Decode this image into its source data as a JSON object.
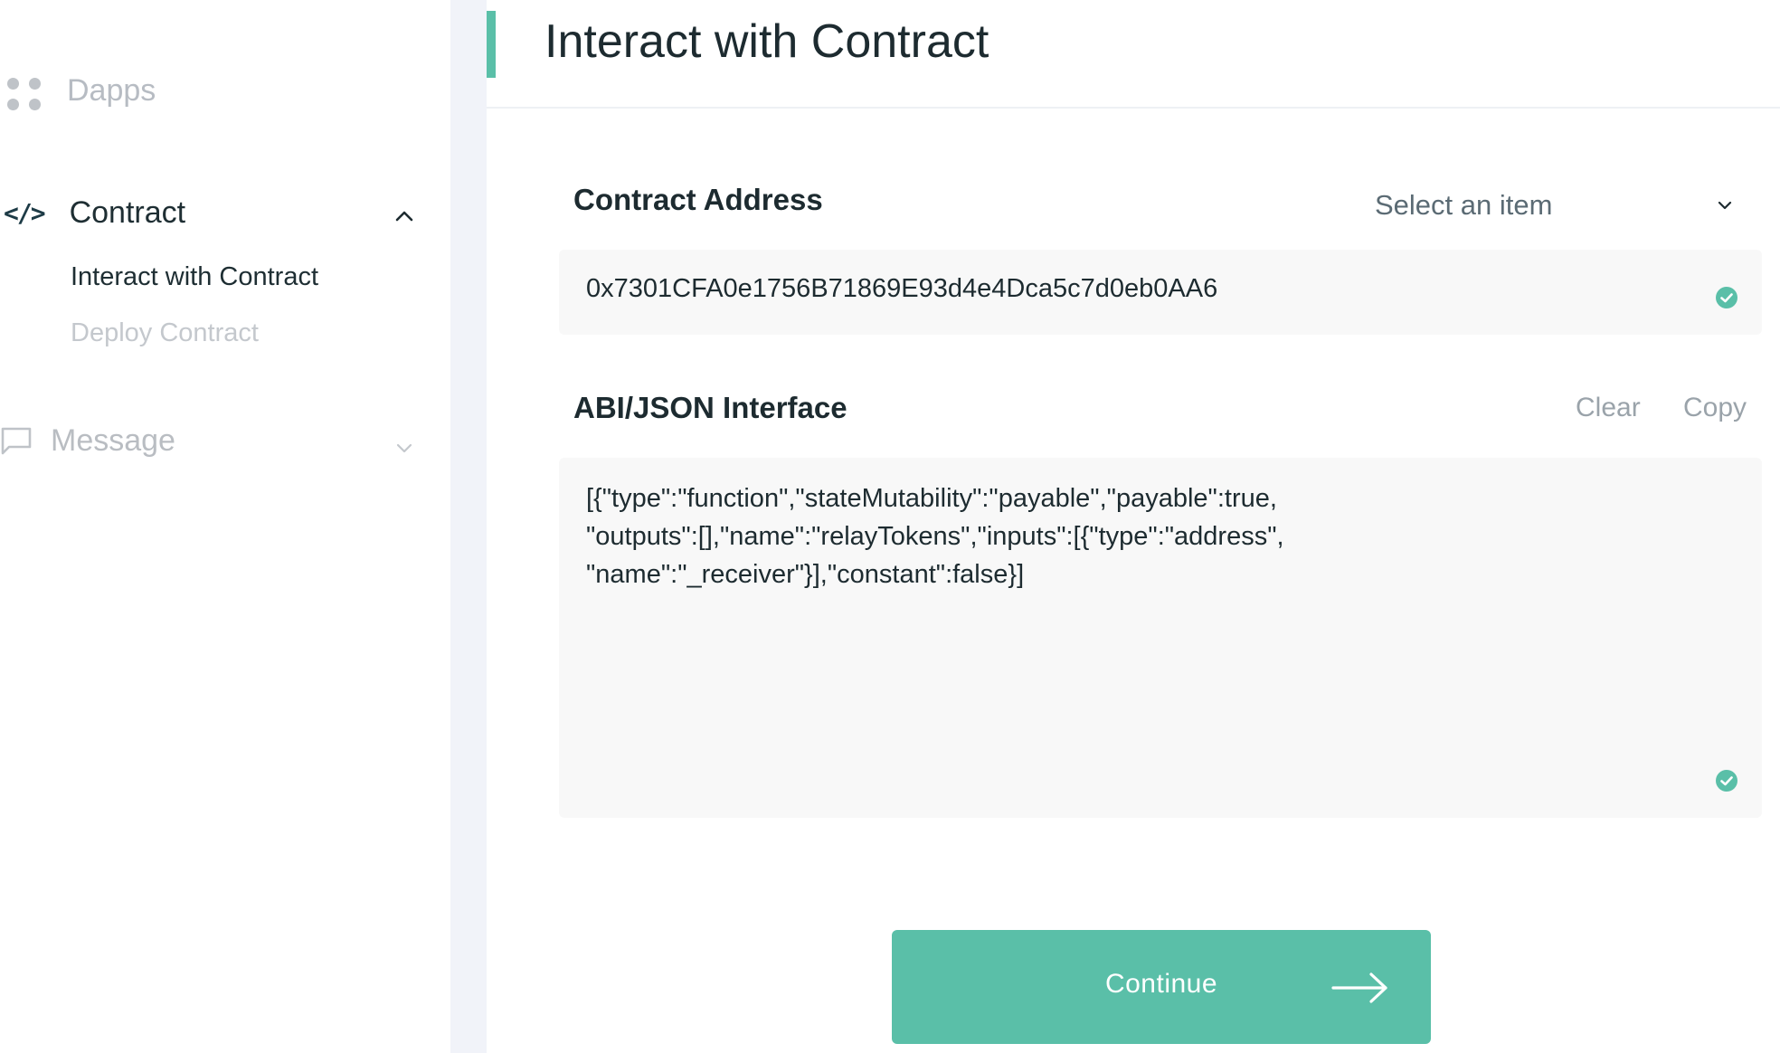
{
  "sidebar": {
    "items": [
      {
        "label": "Dapps",
        "icon": "grid-dots-icon",
        "state": "inactive"
      },
      {
        "label": "Contract",
        "icon": "code-icon",
        "state": "expanded",
        "children": [
          {
            "label": "Interact with Contract",
            "state": "active"
          },
          {
            "label": "Deploy Contract",
            "state": "inactive"
          }
        ]
      },
      {
        "label": "Message",
        "icon": "message-icon",
        "state": "collapsed"
      }
    ],
    "code_glyph": "</>"
  },
  "page": {
    "title": "Interact with Contract"
  },
  "contract_address": {
    "label": "Contract Address",
    "select_placeholder": "Select an item",
    "value": "0x7301CFA0e1756B71869E93d4e4Dca5c7d0eb0AA6",
    "valid": true
  },
  "abi": {
    "label": "ABI/JSON Interface",
    "clear_label": "Clear",
    "copy_label": "Copy",
    "value": "[{\"type\":\"function\",\"stateMutability\":\"payable\",\"payable\":true,\n\"outputs\":[],\"name\":\"relayTokens\",\"inputs\":[{\"type\":\"address\",\n\"name\":\"_receiver\"}],\"constant\":false}]",
    "valid": true
  },
  "actions": {
    "continue_label": "Continue"
  },
  "colors": {
    "accent": "#5abfa8",
    "text": "#1d2b30",
    "muted": "#b7bcc3"
  }
}
